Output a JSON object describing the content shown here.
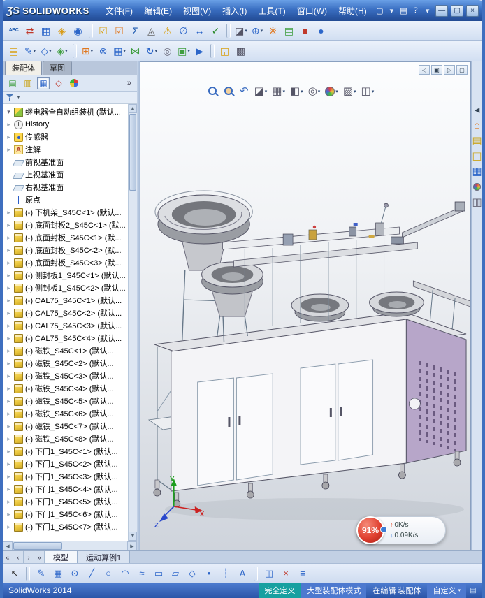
{
  "window": {
    "logo_mark": "ƷS",
    "logo": "SOLIDWORKS",
    "menus": [
      {
        "name": "menu-file",
        "label": "文件(F)"
      },
      {
        "name": "menu-edit",
        "label": "编辑(E)"
      },
      {
        "name": "menu-view",
        "label": "视图(V)"
      },
      {
        "name": "menu-insert",
        "label": "插入(I)"
      },
      {
        "name": "menu-tools",
        "label": "工具(T)"
      },
      {
        "name": "menu-window",
        "label": "窗口(W)"
      },
      {
        "name": "menu-help",
        "label": "帮助(H)"
      }
    ],
    "quick_icons": [
      {
        "name": "new-document",
        "glyph": "▢",
        "color": "#ffffff"
      },
      {
        "name": "new-document-dropdown",
        "glyph": "▾",
        "color": "#e6eefa"
      },
      {
        "name": "file-properties",
        "glyph": "▤",
        "color": "#ffffff"
      },
      {
        "name": "help",
        "glyph": "?",
        "color": "#ffffff"
      },
      {
        "name": "help-dropdown",
        "glyph": "▾",
        "color": "#e6eefa"
      }
    ],
    "controls": [
      {
        "name": "minimize-button",
        "glyph": "—"
      },
      {
        "name": "maximize-button",
        "glyph": "▢"
      },
      {
        "name": "close-button",
        "glyph": "×"
      }
    ]
  },
  "toolbar_top": {
    "icons": [
      {
        "name": "spell-checker",
        "glyph": "ABC",
        "color": "#1856ae",
        "cls": "small"
      },
      {
        "name": "find-replace",
        "glyph": "⇄",
        "color": "#c0392b"
      },
      {
        "name": "design-table",
        "glyph": "▦",
        "color": "#2c66c9"
      },
      {
        "name": "import-diagnostics",
        "glyph": "◈",
        "color": "#d89c1a"
      },
      {
        "name": "costing",
        "glyph": "◉",
        "color": "#2c66c9"
      },
      {
        "name": "separator",
        "cls": "sep",
        "inter": "false"
      },
      {
        "name": "selection-filter",
        "glyph": "☑",
        "color": "#d8a013"
      },
      {
        "name": "verification",
        "glyph": "☑",
        "color": "#e07820"
      },
      {
        "name": "equations",
        "glyph": "Σ",
        "color": "#1856ae"
      },
      {
        "name": "mass-properties",
        "glyph": "◬",
        "color": "#666666"
      },
      {
        "name": "interference-detection",
        "glyph": "⚠",
        "color": "#d8a013"
      },
      {
        "name": "measure",
        "glyph": "∅",
        "color": "#2c66c9"
      },
      {
        "name": "dimension-check",
        "glyph": "↔",
        "color": "#2c66c9"
      },
      {
        "name": "performance-evaluation",
        "glyph": "✓",
        "color": "#2e8b2e"
      },
      {
        "name": "separator",
        "cls": "sep",
        "inter": "false"
      },
      {
        "name": "section-view",
        "glyph": "◪",
        "color": "#555566",
        "dd": "▾"
      },
      {
        "name": "move-component",
        "glyph": "⊕",
        "color": "#2c66c9",
        "dd": "▾"
      },
      {
        "name": "exploded-view",
        "glyph": "※",
        "color": "#e07820"
      },
      {
        "name": "assembly-visualization",
        "glyph": "▤",
        "color": "#3f9e3f"
      },
      {
        "name": "record-macro",
        "glyph": "■",
        "color": "#c0392b"
      },
      {
        "name": "appearances",
        "glyph": "●",
        "color": "#2c66c9"
      }
    ]
  },
  "toolbar_second": {
    "icons": [
      {
        "name": "note-annotation",
        "glyph": "▤",
        "color": "#d8a013"
      },
      {
        "name": "sketch",
        "glyph": "✎",
        "color": "#2c66c9",
        "dd": "▾"
      },
      {
        "name": "smart-dimension",
        "glyph": "◇",
        "color": "#2c66c9",
        "dd": "▾"
      },
      {
        "name": "reference-geometry",
        "glyph": "◈",
        "color": "#3f9e3f",
        "dd": "▾"
      },
      {
        "name": "separator",
        "cls": "sep",
        "inter": "false"
      },
      {
        "name": "insert-components",
        "glyph": "⊞",
        "color": "#e07820",
        "dd": "▾"
      },
      {
        "name": "mate",
        "glyph": "⊗",
        "color": "#2c66c9"
      },
      {
        "name": "linear-component-pattern",
        "glyph": "▦",
        "color": "#2c66c9",
        "dd": "▾"
      },
      {
        "name": "smart-fasteners",
        "glyph": "⋈",
        "color": "#3f9e3f"
      },
      {
        "name": "move-rotate-component",
        "glyph": "↻",
        "color": "#2c66c9",
        "dd": "▾"
      },
      {
        "name": "show-hidden-components",
        "glyph": "◎",
        "color": "#666677"
      },
      {
        "name": "assembly-features",
        "glyph": "▣",
        "color": "#3f9e3f",
        "dd": "▾"
      },
      {
        "name": "new-motion-study",
        "glyph": "▶",
        "color": "#2c66c9"
      },
      {
        "name": "separator",
        "cls": "sep",
        "inter": "false"
      },
      {
        "name": "instant-3d",
        "glyph": "◱",
        "color": "#d8a013"
      },
      {
        "name": "large-assembly-mode",
        "glyph": "▩",
        "color": "#555566"
      }
    ]
  },
  "panel": {
    "tabs": [
      {
        "name": "tab-assembly",
        "label": "装配体",
        "state": "active"
      },
      {
        "name": "tab-sketch",
        "label": "草图",
        "state": ""
      }
    ],
    "manager_tabs": [
      {
        "name": "featuremanager-tree-tab",
        "glyph": "▤",
        "color": "#3f9e3f"
      },
      {
        "name": "propertymanager-tab",
        "glyph": "▥",
        "color": "#caa41a"
      },
      {
        "name": "configurationmanager-tab",
        "glyph": "▦",
        "color": "#2c66c9",
        "state": "pressed"
      },
      {
        "name": "dimxpertmanager-tab",
        "glyph": "◇",
        "color": "#c0392b"
      },
      {
        "name": "displaymanager-tab",
        "cls": "pie"
      }
    ],
    "overflow": "»",
    "filter_dd": "▼",
    "tree": {
      "items": [
        {
          "n": "tree-item-root-assembly",
          "a": "open",
          "i": "asm",
          "label": "继电器全自动组装机 (默认..."
        },
        {
          "n": "tree-item-history",
          "a": "closed",
          "i": "hist",
          "label": "History"
        },
        {
          "n": "tree-item-sensors",
          "a": "closed",
          "i": "sens",
          "label": "传感器"
        },
        {
          "n": "tree-item-annotations",
          "a": "closed",
          "i": "ann",
          "label": "注解"
        },
        {
          "n": "tree-item-front-plane",
          "a": "none",
          "i": "plane",
          "label": "前视基准面"
        },
        {
          "n": "tree-item-top-plane",
          "a": "none",
          "i": "plane",
          "label": "上视基准面"
        },
        {
          "n": "tree-item-right-plane",
          "a": "none",
          "i": "plane",
          "label": "右视基准面"
        },
        {
          "n": "tree-item-origin",
          "a": "none",
          "i": "origin",
          "label": "原点"
        },
        {
          "a": "closed",
          "i": "part",
          "label": "(-) 下机架_S45C<1> (默认..."
        },
        {
          "a": "closed",
          "i": "part",
          "label": "(-) 底面封板2_S45C<1> (默..."
        },
        {
          "a": "closed",
          "i": "part",
          "label": "(-) 底面封板_S45C<1> (默..."
        },
        {
          "a": "closed",
          "i": "part",
          "label": "(-) 底面封板_S45C<2> (默..."
        },
        {
          "a": "closed",
          "i": "part",
          "label": "(-) 底面封板_S45C<3> (默..."
        },
        {
          "a": "closed",
          "i": "part",
          "label": "(-) 侧封板1_S45C<1> (默认..."
        },
        {
          "a": "closed",
          "i": "part",
          "label": "(-) 侧封板1_S45C<2> (默认..."
        },
        {
          "a": "closed",
          "i": "part",
          "label": "(-) CAL75_S45C<1> (默认..."
        },
        {
          "a": "closed",
          "i": "part",
          "label": "(-) CAL75_S45C<2> (默认..."
        },
        {
          "a": "closed",
          "i": "part",
          "label": "(-) CAL75_S45C<3> (默认..."
        },
        {
          "a": "closed",
          "i": "part",
          "label": "(-) CAL75_S45C<4> (默认..."
        },
        {
          "a": "closed",
          "i": "part",
          "label": "(-) 磁铁_S45C<1> (默认..."
        },
        {
          "a": "closed",
          "i": "part",
          "label": "(-) 磁铁_S45C<2> (默认..."
        },
        {
          "a": "closed",
          "i": "part",
          "label": "(-) 磁铁_S45C<3> (默认..."
        },
        {
          "a": "closed",
          "i": "part",
          "label": "(-) 磁铁_S45C<4> (默认..."
        },
        {
          "a": "closed",
          "i": "part",
          "label": "(-) 磁铁_S45C<5> (默认..."
        },
        {
          "a": "closed",
          "i": "part",
          "label": "(-) 磁铁_S45C<6> (默认..."
        },
        {
          "a": "closed",
          "i": "part",
          "label": "(-) 磁铁_S45C<7> (默认..."
        },
        {
          "a": "closed",
          "i": "part",
          "label": "(-) 磁铁_S45C<8> (默认..."
        },
        {
          "a": "closed",
          "i": "part",
          "label": "(-) 下门1_S45C<1> (默认..."
        },
        {
          "a": "closed",
          "i": "part",
          "label": "(-) 下门1_S45C<2> (默认..."
        },
        {
          "a": "closed",
          "i": "part",
          "label": "(-) 下门1_S45C<3> (默认..."
        },
        {
          "a": "closed",
          "i": "part",
          "label": "(-) 下门1_S45C<4> (默认..."
        },
        {
          "a": "closed",
          "i": "part",
          "label": "(-) 下门1_S45C<5> (默认..."
        },
        {
          "a": "closed",
          "i": "part",
          "label": "(-) 下门1_S45C<6> (默认..."
        },
        {
          "a": "closed",
          "i": "part",
          "label": "(-) 下门1_S45C<7> (默认..."
        }
      ]
    }
  },
  "viewport": {
    "hud": [
      {
        "name": "zoom-to-fit",
        "cls": "mag"
      },
      {
        "name": "zoom-to-area",
        "cls": "mag2"
      },
      {
        "name": "previous-view",
        "glyph": "↶",
        "color": "#3a6cc0"
      },
      {
        "name": "section-view",
        "glyph": "◪",
        "color": "#555566",
        "dd": "▾"
      },
      {
        "name": "view-orientation",
        "glyph": "▦",
        "color": "#555566",
        "dd": "▾"
      },
      {
        "name": "display-style",
        "glyph": "◧",
        "color": "#555566",
        "dd": "▾"
      },
      {
        "name": "hide-show-items",
        "glyph": "◎",
        "color": "#555566",
        "dd": "▾"
      },
      {
        "name": "edit-appearance",
        "cls": "ball",
        "dd": "▾"
      },
      {
        "name": "apply-scene",
        "glyph": "▨",
        "color": "#555566",
        "dd": "▾"
      },
      {
        "name": "view-settings",
        "glyph": "◫",
        "color": "#555566",
        "dd": "▾"
      }
    ],
    "window_buttons": [
      {
        "name": "viewport-previous-window",
        "glyph": "◁"
      },
      {
        "name": "viewport-restore-window",
        "glyph": "▣"
      },
      {
        "name": "viewport-next-window",
        "glyph": "▷"
      },
      {
        "name": "viewport-maximize-window",
        "glyph": "▢"
      }
    ],
    "task_pane": [
      {
        "name": "collapse-task-pane",
        "glyph": "◂",
        "color": "#334455"
      },
      {
        "name": "solidworks-resources",
        "glyph": "⌂",
        "color": "#e07820"
      },
      {
        "name": "design-library",
        "glyph": "▤",
        "color": "#caa41a"
      },
      {
        "name": "file-explorer",
        "glyph": "◫",
        "color": "#caa41a"
      },
      {
        "name": "view-palette",
        "glyph": "▦",
        "color": "#2c66c9"
      },
      {
        "name": "appearances-scenes",
        "cls": "ball"
      },
      {
        "name": "custom-properties",
        "glyph": "▥",
        "color": "#666677"
      }
    ],
    "triad": {
      "x": "X",
      "y": "Y",
      "z": "Z"
    },
    "speedball": {
      "progress": "91%",
      "up_arrow": "↑",
      "upload": "0K/s",
      "down_arrow": "↓",
      "download": "0.09K/s"
    }
  },
  "bottom": {
    "tab_nav": [
      {
        "name": "scroll-tabs-first",
        "glyph": "«"
      },
      {
        "name": "scroll-tabs-prev",
        "glyph": "‹"
      },
      {
        "name": "scroll-tabs-next",
        "glyph": "›"
      },
      {
        "name": "scroll-tabs-last",
        "glyph": "»"
      }
    ],
    "doc_tabs": [
      {
        "name": "tab-model",
        "label": "模型",
        "state": "active"
      },
      {
        "name": "tab-motion-study-1",
        "label": "运动算例1",
        "state": ""
      }
    ],
    "sketch_icons": [
      {
        "name": "select-tool",
        "glyph": "↖",
        "color": "#333333"
      },
      {
        "name": "separator",
        "cls": "sep",
        "inter": "false"
      },
      {
        "name": "sketch-tool",
        "glyph": "✎",
        "color": "#2c66c9"
      },
      {
        "name": "grid-system",
        "glyph": "▦",
        "color": "#2c66c9"
      },
      {
        "name": "circle-tool",
        "glyph": "⊙",
        "color": "#2c66c9"
      },
      {
        "name": "line-tool",
        "glyph": "╱",
        "color": "#2c66c9"
      },
      {
        "name": "ellipse-tool",
        "glyph": "○",
        "color": "#2c66c9"
      },
      {
        "name": "arc-tool",
        "glyph": "◠",
        "color": "#2c66c9"
      },
      {
        "name": "spline-tool",
        "glyph": "≈",
        "color": "#2c66c9"
      },
      {
        "name": "rectangle-tool",
        "glyph": "▭",
        "color": "#2c66c9"
      },
      {
        "name": "slot-tool",
        "glyph": "▱",
        "color": "#2c66c9"
      },
      {
        "name": "polygon-tool",
        "glyph": "◇",
        "color": "#2c66c9"
      },
      {
        "name": "point-tool",
        "glyph": "•",
        "color": "#2c66c9"
      },
      {
        "name": "centerline-tool",
        "glyph": "┆",
        "color": "#2c66c9"
      },
      {
        "name": "text-tool",
        "glyph": "A",
        "color": "#2c66c9"
      },
      {
        "name": "separator",
        "cls": "sep",
        "inter": "false"
      },
      {
        "name": "mirror-entities",
        "glyph": "◫",
        "color": "#2c66c9"
      },
      {
        "name": "trim-entities",
        "glyph": "×",
        "color": "#c0392b"
      },
      {
        "name": "convert-entities",
        "glyph": "≡",
        "color": "#2c66c9"
      }
    ],
    "status": {
      "app": "SolidWorks 2014",
      "fully_defined": "完全定义",
      "mode": "大型装配体模式",
      "editing": "在编辑 装配体",
      "custom": "自定义",
      "custom_dd": "▾",
      "grip": "▤"
    }
  }
}
